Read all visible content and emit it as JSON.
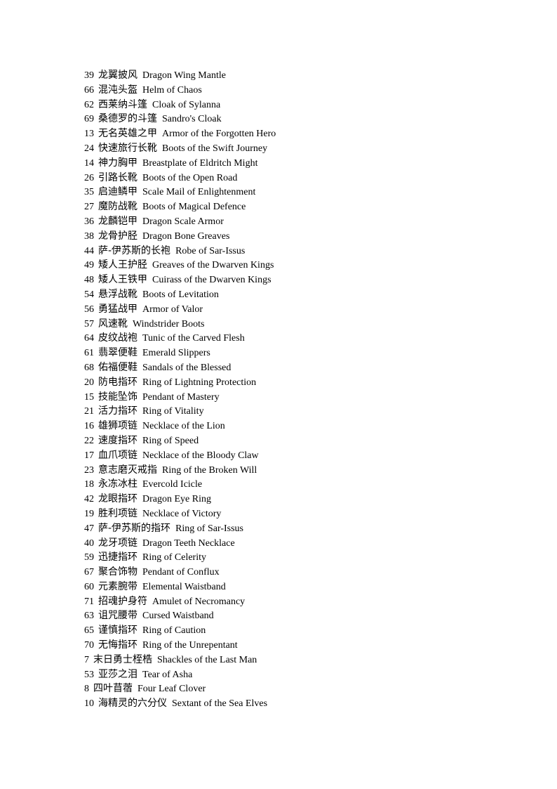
{
  "items": [
    {
      "num": "39",
      "cn": "龙翼披风",
      "en": "Dragon Wing Mantle"
    },
    {
      "num": "66",
      "cn": "混沌头盔",
      "en": "Helm of Chaos"
    },
    {
      "num": "62",
      "cn": "西莱纳斗篷",
      "en": "Cloak of Sylanna"
    },
    {
      "num": "69",
      "cn": "桑德罗的斗篷",
      "en": "Sandro's Cloak"
    },
    {
      "num": "13",
      "cn": "无名英雄之甲",
      "en": "Armor of the Forgotten Hero"
    },
    {
      "num": "24",
      "cn": "快速旅行长靴",
      "en": "Boots of the Swift Journey"
    },
    {
      "num": "14",
      "cn": "神力胸甲",
      "en": "Breastplate of Eldritch Might"
    },
    {
      "num": "26",
      "cn": "引路长靴",
      "en": "Boots of the Open Road"
    },
    {
      "num": "35",
      "cn": "启迪鳞甲",
      "en": "Scale Mail of Enlightenment"
    },
    {
      "num": "27",
      "cn": "魔防战靴",
      "en": "Boots of Magical Defence"
    },
    {
      "num": "36",
      "cn": "龙麟铠甲",
      "en": "Dragon Scale Armor"
    },
    {
      "num": "38",
      "cn": "龙骨护胫",
      "en": "Dragon Bone Greaves"
    },
    {
      "num": "44",
      "cn": "萨-伊苏斯的长袍",
      "en": "Robe of Sar-Issus"
    },
    {
      "num": "49",
      "cn": "矮人王护胫",
      "en": "Greaves of the Dwarven Kings"
    },
    {
      "num": "48",
      "cn": "矮人王铁甲",
      "en": "Cuirass of the Dwarven Kings"
    },
    {
      "num": "54",
      "cn": "悬浮战靴",
      "en": "Boots of Levitation"
    },
    {
      "num": "56",
      "cn": "勇猛战甲",
      "en": "Armor of Valor"
    },
    {
      "num": "57",
      "cn": "风速靴",
      "en": "Windstrider Boots"
    },
    {
      "num": "64",
      "cn": "皮纹战袍",
      "en": "Tunic of the Carved Flesh"
    },
    {
      "num": "61",
      "cn": "翡翠便鞋",
      "en": "Emerald Slippers"
    },
    {
      "num": "68",
      "cn": "佑福便鞋",
      "en": "Sandals of the Blessed"
    },
    {
      "num": "20",
      "cn": "防电指环",
      "en": "Ring of Lightning Protection"
    },
    {
      "num": "15",
      "cn": "技能坠饰",
      "en": "Pendant of Mastery"
    },
    {
      "num": "21",
      "cn": "活力指环",
      "en": "Ring of Vitality"
    },
    {
      "num": "16",
      "cn": "雄狮项链",
      "en": "Necklace of the Lion"
    },
    {
      "num": "22",
      "cn": "速度指环",
      "en": "Ring of Speed"
    },
    {
      "num": "17",
      "cn": "血爪项链",
      "en": "Necklace of the Bloody Claw"
    },
    {
      "num": "23",
      "cn": "意志磨灭戒指",
      "en": "Ring of the Broken Will"
    },
    {
      "num": "18",
      "cn": "永冻冰柱",
      "en": "Evercold Icicle"
    },
    {
      "num": "42",
      "cn": "龙眼指环",
      "en": "Dragon Eye Ring"
    },
    {
      "num": "19",
      "cn": "胜利项链",
      "en": "Necklace of Victory"
    },
    {
      "num": "47",
      "cn": "萨-伊苏斯的指环",
      "en": "Ring of Sar-Issus"
    },
    {
      "num": "40",
      "cn": "龙牙项链",
      "en": "Dragon Teeth Necklace"
    },
    {
      "num": "59",
      "cn": "迅捷指环",
      "en": "Ring of Celerity"
    },
    {
      "num": "67",
      "cn": "聚合饰物",
      "en": "Pendant of Conflux"
    },
    {
      "num": "60",
      "cn": "元素腕带",
      "en": "Elemental Waistband"
    },
    {
      "num": "71",
      "cn": "招魂护身符",
      "en": "Amulet of Necromancy"
    },
    {
      "num": "63",
      "cn": "诅咒腰带",
      "en": "Cursed Waistband"
    },
    {
      "num": "65",
      "cn": "谨慎指环",
      "en": "Ring of Caution"
    },
    {
      "num": "70",
      "cn": "无悔指环",
      "en": "Ring of the Unrepentant"
    },
    {
      "num": "7",
      "cn": "末日勇士桎梏",
      "en": "Shackles of the Last Man"
    },
    {
      "num": "53",
      "cn": "亚莎之泪",
      "en": "Tear of Asha"
    },
    {
      "num": "8",
      "cn": "四叶苜蓿",
      "en": "Four Leaf Clover"
    },
    {
      "num": "10",
      "cn": "海精灵的六分仪",
      "en": "Sextant of the Sea Elves"
    }
  ]
}
